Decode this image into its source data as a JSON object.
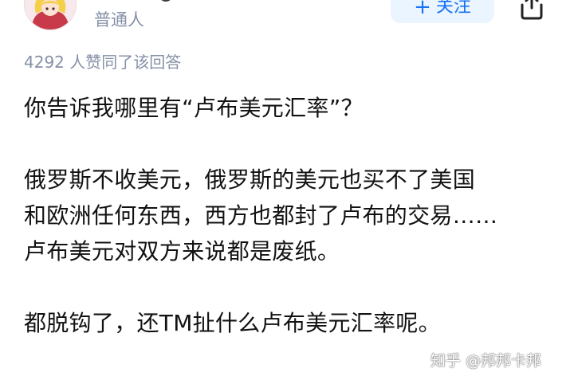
{
  "author": {
    "role": "普通人"
  },
  "actions": {
    "follow_plus": "+",
    "follow_label": "关注",
    "share_icon": "share-icon"
  },
  "stats": {
    "vote_line": "4292 人赞同了该回答"
  },
  "answer": {
    "paragraphs": [
      [
        "你告诉我哪里有“卢布美元汇率”？"
      ],
      [
        "俄罗斯不收美元，俄罗斯的美元也买不了美国",
        "和欧洲任何东西，西方也都封了卢布的交易……",
        "卢布美元对双方来说都是废纸。"
      ],
      [
        "都脱钩了，还TM扯什么卢布美元汇率呢。"
      ]
    ]
  },
  "watermark": "知乎 @邦邦卡邦",
  "colors": {
    "accent": "#1772f6",
    "follow_bg": "#ebf5ff",
    "meta_text": "#8590a6",
    "body_text": "#121212"
  }
}
